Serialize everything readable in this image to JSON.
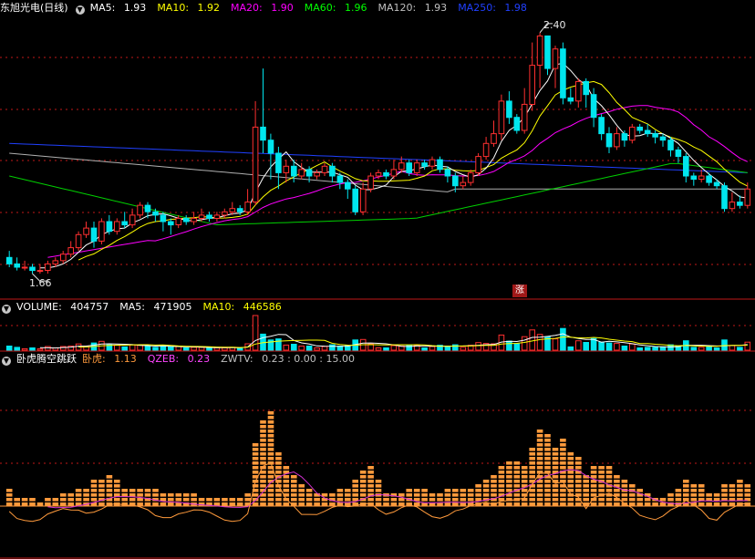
{
  "main": {
    "stock_name": "东旭光电",
    "period": "(日线)",
    "ma_items": [
      {
        "label": "MA5: ",
        "value": "1.93",
        "color": "#ffffff"
      },
      {
        "label": "MA10: ",
        "value": "1.92",
        "color": "#ffff00"
      },
      {
        "label": "MA20: ",
        "value": "1.90",
        "color": "#ff00ff"
      },
      {
        "label": "MA60: ",
        "value": "1.96",
        "color": "#00ff00"
      },
      {
        "label": "MA120: ",
        "value": "1.93",
        "color": "#c0c0c0"
      },
      {
        "label": "MA250: ",
        "value": "1.98",
        "color": "#2040ff"
      }
    ],
    "high_label": "2.40",
    "low_label": "1.66",
    "zhang_badge": "涨"
  },
  "volume": {
    "label": "VOLUME: ",
    "value": "404757",
    "ma5_label": "MA5: ",
    "ma5_value": "471905",
    "ma10_label": "MA10: ",
    "ma10_value": "446586"
  },
  "indicator": {
    "name": "卧虎腾空跳跃",
    "items": [
      {
        "label": "卧虎: ",
        "value": "1.13",
        "color": "#ff9a3c"
      },
      {
        "label": "QZEB: ",
        "value": "0.23",
        "color": "#ff44ff"
      },
      {
        "label": "ZWTV: ",
        "value": "0.23 : 0.00 : 15.00",
        "color": "#c0c0c0"
      }
    ]
  },
  "colors": {
    "up": "#ff3030",
    "down": "#00e5ee",
    "orange": "#ff9a3c"
  },
  "chart_data": {
    "type": "candlestick",
    "price_ylim": [
      1.62,
      2.46
    ],
    "candles": [
      [
        1.72,
        1.7,
        1.74,
        1.69
      ],
      [
        1.7,
        1.69,
        1.72,
        1.68
      ],
      [
        1.69,
        1.69,
        1.71,
        1.68
      ],
      [
        1.69,
        1.68,
        1.7,
        1.67
      ],
      [
        1.68,
        1.68,
        1.7,
        1.67
      ],
      [
        1.68,
        1.7,
        1.71,
        1.67
      ],
      [
        1.7,
        1.71,
        1.72,
        1.69
      ],
      [
        1.71,
        1.73,
        1.74,
        1.7
      ],
      [
        1.73,
        1.75,
        1.77,
        1.72
      ],
      [
        1.75,
        1.79,
        1.8,
        1.74
      ],
      [
        1.79,
        1.81,
        1.83,
        1.78
      ],
      [
        1.81,
        1.77,
        1.83,
        1.75
      ],
      [
        1.77,
        1.83,
        1.84,
        1.76
      ],
      [
        1.83,
        1.8,
        1.85,
        1.79
      ],
      [
        1.8,
        1.83,
        1.84,
        1.79
      ],
      [
        1.83,
        1.82,
        1.86,
        1.81
      ],
      [
        1.82,
        1.85,
        1.87,
        1.81
      ],
      [
        1.85,
        1.88,
        1.89,
        1.84
      ],
      [
        1.88,
        1.86,
        1.89,
        1.84
      ],
      [
        1.86,
        1.85,
        1.87,
        1.83
      ],
      [
        1.85,
        1.83,
        1.86,
        1.8
      ],
      [
        1.83,
        1.82,
        1.84,
        1.79
      ],
      [
        1.82,
        1.84,
        1.85,
        1.81
      ],
      [
        1.84,
        1.83,
        1.85,
        1.82
      ],
      [
        1.83,
        1.84,
        1.86,
        1.82
      ],
      [
        1.84,
        1.85,
        1.87,
        1.83
      ],
      [
        1.85,
        1.84,
        1.86,
        1.83
      ],
      [
        1.84,
        1.85,
        1.86,
        1.83
      ],
      [
        1.85,
        1.86,
        1.87,
        1.84
      ],
      [
        1.86,
        1.87,
        1.89,
        1.85
      ],
      [
        1.87,
        1.86,
        1.88,
        1.85
      ],
      [
        1.86,
        1.89,
        1.93,
        1.85
      ],
      [
        1.89,
        2.12,
        2.2,
        1.88
      ],
      [
        2.12,
        2.08,
        2.3,
        2.04
      ],
      [
        2.08,
        2.04,
        2.1,
        1.96
      ],
      [
        2.04,
        1.98,
        2.06,
        1.93
      ],
      [
        1.98,
        2.0,
        2.02,
        1.95
      ],
      [
        2.0,
        1.97,
        2.02,
        1.95
      ],
      [
        1.97,
        1.99,
        2.01,
        1.96
      ],
      [
        1.99,
        1.97,
        2.0,
        1.95
      ],
      [
        1.97,
        1.98,
        1.99,
        1.96
      ],
      [
        1.98,
        2.0,
        2.01,
        1.97
      ],
      [
        2.0,
        1.97,
        2.01,
        1.95
      ],
      [
        1.97,
        1.95,
        1.98,
        1.93
      ],
      [
        1.95,
        1.93,
        1.96,
        1.9
      ],
      [
        1.93,
        1.86,
        1.94,
        1.85
      ],
      [
        1.86,
        1.93,
        1.95,
        1.85
      ],
      [
        1.93,
        1.97,
        1.98,
        1.92
      ],
      [
        1.97,
        1.98,
        1.99,
        1.96
      ],
      [
        1.98,
        1.97,
        1.99,
        1.96
      ],
      [
        1.97,
        1.99,
        2.02,
        1.96
      ],
      [
        1.99,
        2.01,
        2.03,
        1.98
      ],
      [
        2.01,
        1.98,
        2.02,
        1.97
      ],
      [
        1.98,
        2.01,
        2.02,
        1.97
      ],
      [
        2.01,
        2.0,
        2.02,
        1.99
      ],
      [
        2.0,
        2.02,
        2.03,
        1.99
      ],
      [
        2.02,
        1.99,
        2.03,
        1.98
      ],
      [
        1.99,
        1.97,
        2.0,
        1.95
      ],
      [
        1.97,
        1.94,
        1.98,
        1.92
      ],
      [
        1.94,
        1.95,
        1.97,
        1.93
      ],
      [
        1.95,
        1.98,
        1.99,
        1.94
      ],
      [
        1.98,
        2.03,
        2.04,
        1.97
      ],
      [
        2.03,
        2.07,
        2.09,
        2.02
      ],
      [
        2.07,
        2.1,
        2.14,
        2.06
      ],
      [
        2.1,
        2.2,
        2.22,
        2.08
      ],
      [
        2.2,
        2.15,
        2.23,
        2.13
      ],
      [
        2.15,
        2.11,
        2.16,
        2.1
      ],
      [
        2.11,
        2.19,
        2.24,
        2.1
      ],
      [
        2.19,
        2.31,
        2.38,
        2.17
      ],
      [
        2.31,
        2.4,
        2.41,
        2.24
      ],
      [
        2.4,
        2.3,
        2.38,
        2.28
      ],
      [
        2.3,
        2.36,
        2.37,
        2.24
      ],
      [
        2.36,
        2.21,
        2.38,
        2.19
      ],
      [
        2.21,
        2.2,
        2.24,
        2.19
      ],
      [
        2.2,
        2.26,
        2.27,
        2.18
      ],
      [
        2.26,
        2.22,
        2.27,
        2.18
      ],
      [
        2.22,
        2.15,
        2.24,
        2.12
      ],
      [
        2.15,
        2.1,
        2.16,
        2.08
      ],
      [
        2.1,
        2.06,
        2.12,
        2.04
      ],
      [
        2.06,
        2.1,
        2.12,
        2.05
      ],
      [
        2.1,
        2.08,
        2.11,
        2.06
      ],
      [
        2.08,
        2.12,
        2.13,
        2.07
      ],
      [
        2.12,
        2.11,
        2.13,
        2.1
      ],
      [
        2.11,
        2.1,
        2.13,
        2.09
      ],
      [
        2.1,
        2.09,
        2.11,
        2.07
      ],
      [
        2.09,
        2.08,
        2.1,
        2.06
      ],
      [
        2.08,
        2.05,
        2.09,
        2.03
      ],
      [
        2.05,
        2.03,
        2.06,
        2.01
      ],
      [
        2.03,
        1.97,
        2.04,
        1.95
      ],
      [
        1.97,
        1.96,
        1.98,
        1.94
      ],
      [
        1.96,
        1.97,
        1.99,
        1.95
      ],
      [
        1.97,
        1.95,
        1.98,
        1.94
      ],
      [
        1.95,
        1.94,
        1.96,
        1.93
      ],
      [
        1.94,
        1.87,
        1.95,
        1.86
      ],
      [
        1.87,
        1.89,
        1.92,
        1.86
      ],
      [
        1.89,
        1.88,
        1.91,
        1.87
      ],
      [
        1.88,
        1.93,
        1.95,
        1.87
      ]
    ]
  }
}
